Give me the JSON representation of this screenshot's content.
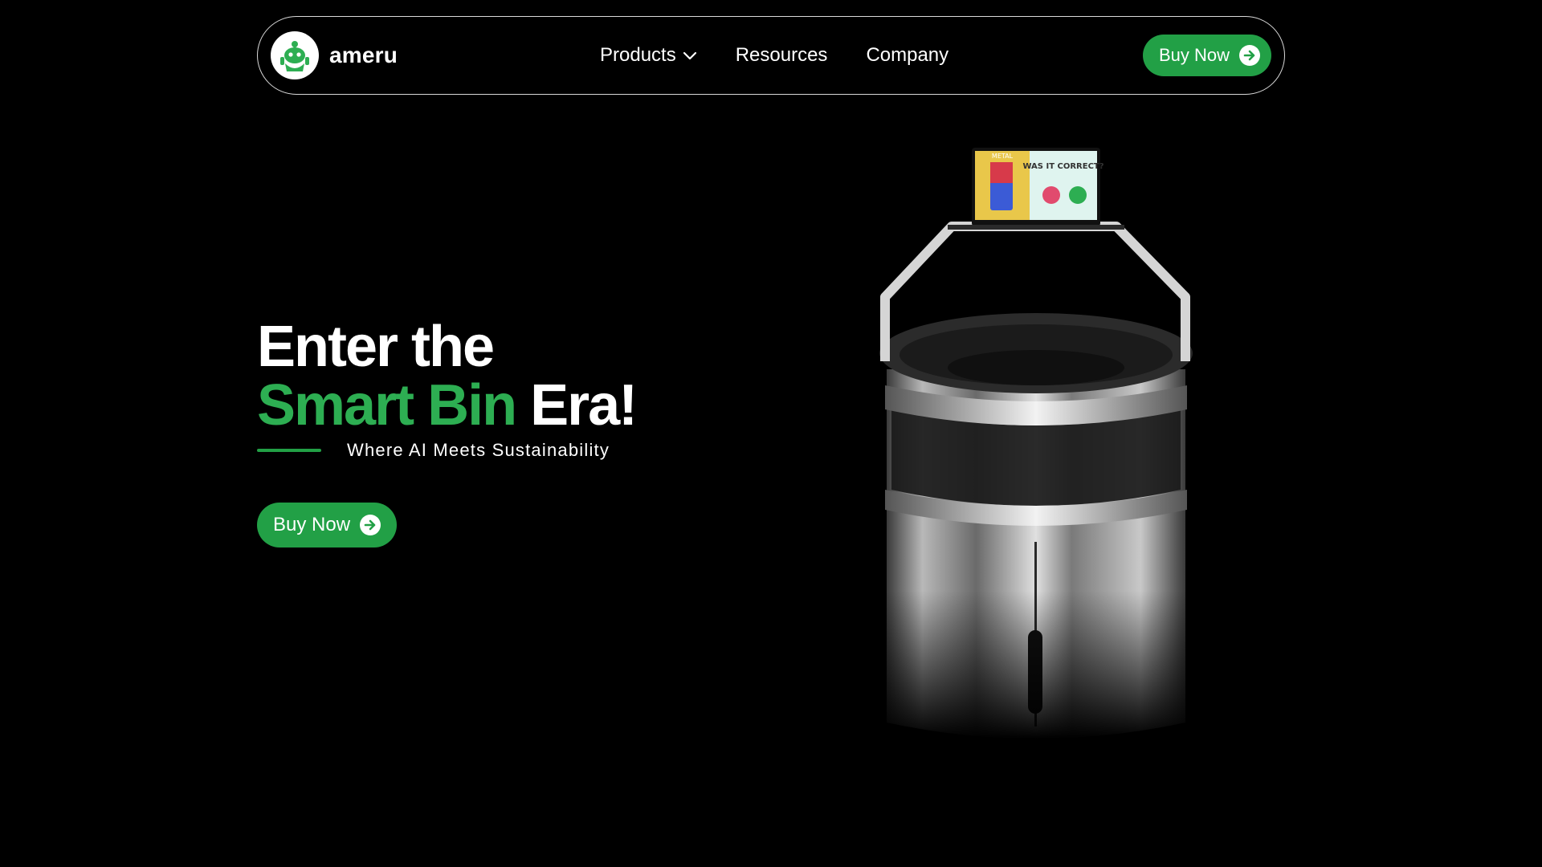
{
  "brand": {
    "name": "ameru",
    "logo_icon": "robot-icon"
  },
  "nav": {
    "items": [
      {
        "label": "Products",
        "has_dropdown": true
      },
      {
        "label": "Resources"
      },
      {
        "label": "Company"
      }
    ],
    "cta_label": "Buy Now"
  },
  "hero": {
    "title_line1": "Enter the",
    "title_highlight": "Smart Bin",
    "title_rest": "Era!",
    "tagline": "Where AI Meets Sustainability",
    "cta_label": "Buy Now"
  },
  "product_screen": {
    "left_label": "METAL",
    "question": "WAS IT CORRECT?"
  },
  "colors": {
    "accent": "#22a046",
    "accent_text": "#2dae52",
    "background": "#000000",
    "text": "#ffffff"
  }
}
